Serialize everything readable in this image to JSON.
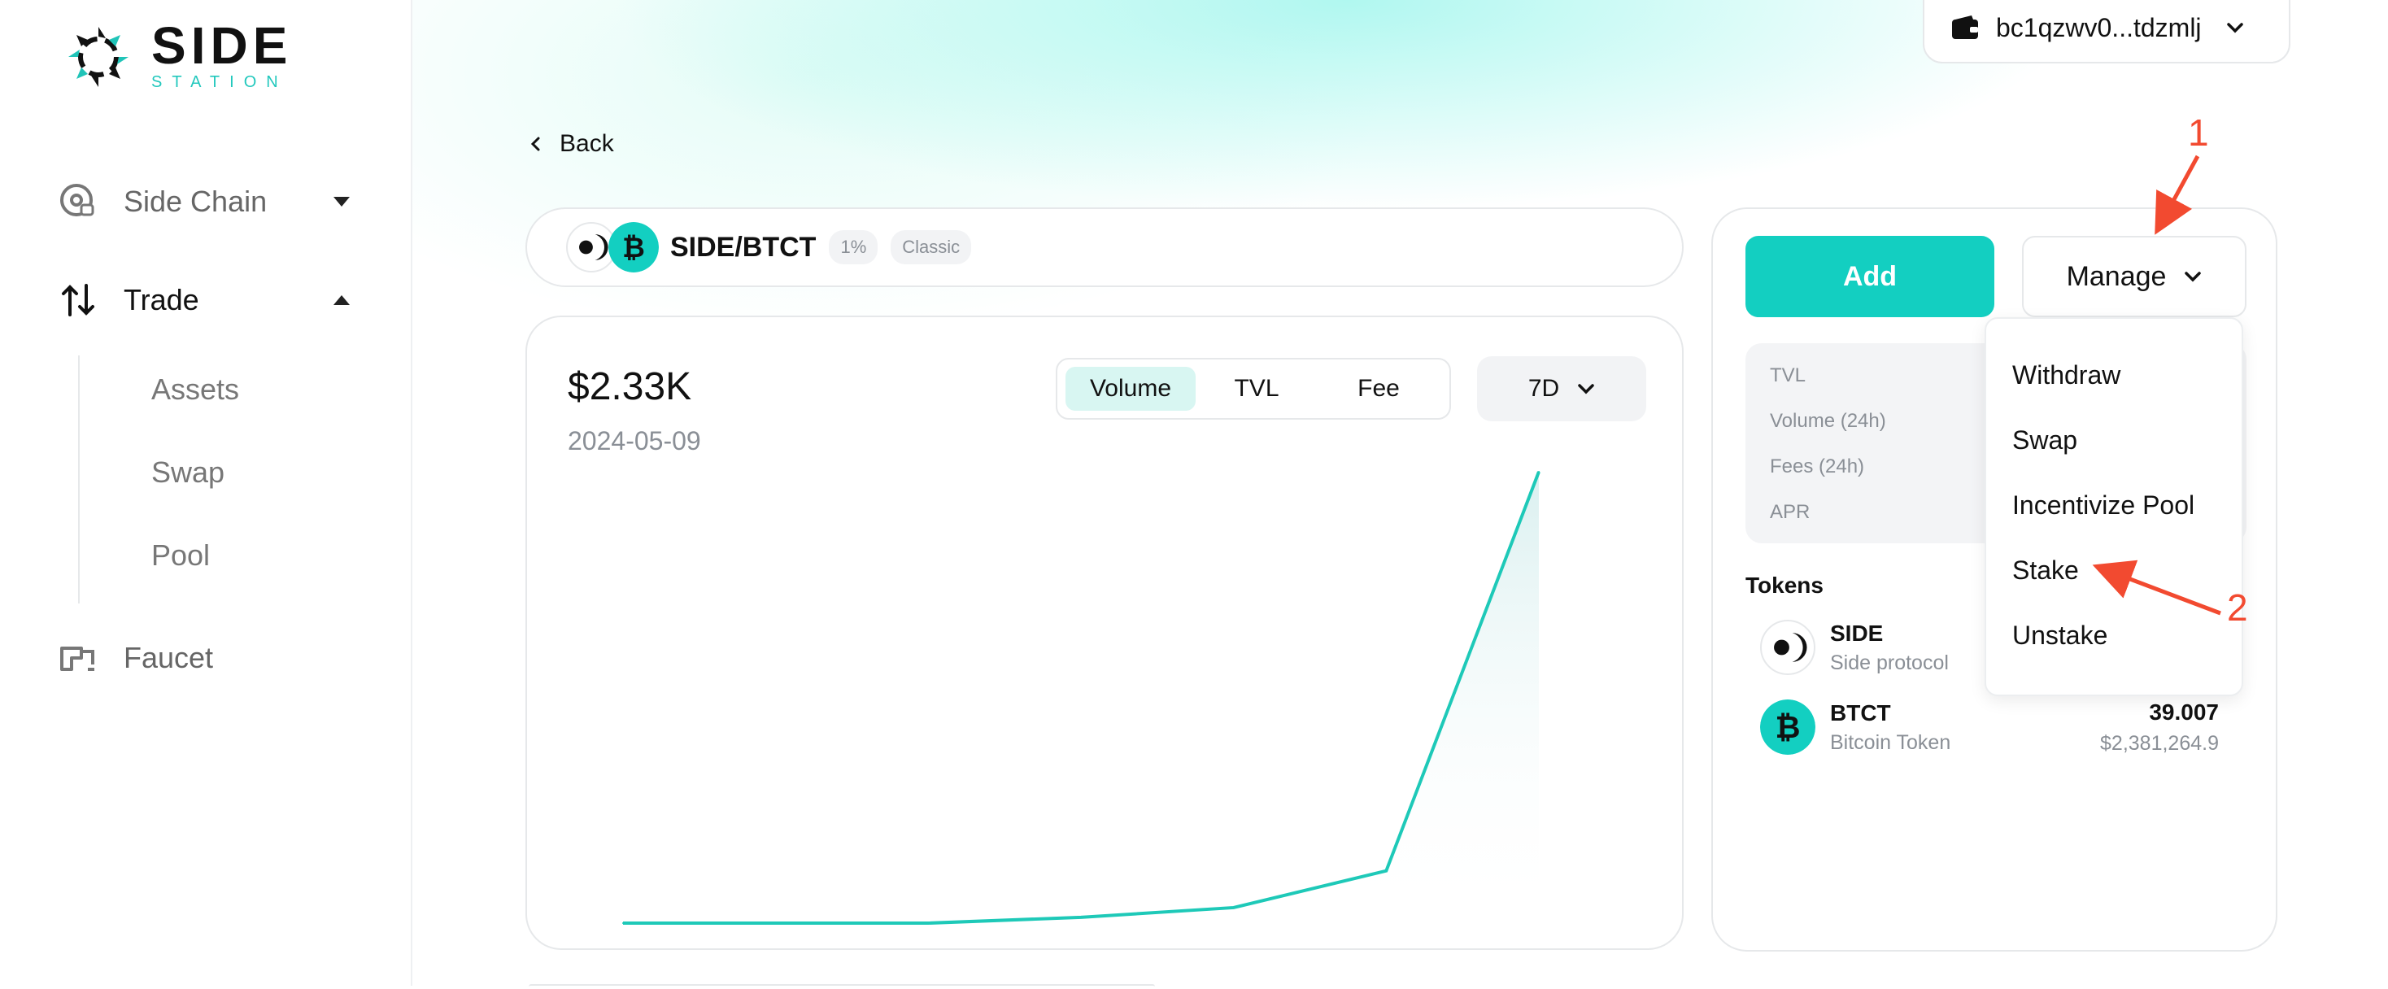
{
  "brand": {
    "title": "SIDE",
    "subtitle": "STATION",
    "accent": "#13cfc1"
  },
  "sidebar": {
    "items": [
      {
        "label": "Side Chain",
        "icon": "side-chain-icon"
      },
      {
        "label": "Trade",
        "icon": "trade-arrows-icon"
      },
      {
        "label": "Faucet",
        "icon": "faucet-icon"
      }
    ],
    "trade_sub": [
      "Assets",
      "Swap",
      "Pool"
    ]
  },
  "wallet": {
    "address": "bc1qzwv0...tdzmlj"
  },
  "back_label": "Back",
  "pair": {
    "title": "SIDE/BTCT",
    "fee": "1%",
    "kind": "Classic"
  },
  "chart": {
    "value": "$2.33K",
    "date": "2024-05-09",
    "tabs": [
      "Volume",
      "TVL",
      "Fee"
    ],
    "active_tab": "Volume",
    "period": "7D"
  },
  "chart_data": {
    "type": "area",
    "x": [
      1,
      2,
      3,
      4,
      5,
      6,
      7
    ],
    "values": [
      0,
      0,
      0,
      0.03,
      0.08,
      0.27,
      2.33
    ],
    "title": "",
    "xlabel": "",
    "ylabel": "",
    "grid": false,
    "color": "#1ec9b8"
  },
  "actions": {
    "add": "Add",
    "manage": "Manage"
  },
  "stats": [
    "TVL",
    "Volume (24h)",
    "Fees (24h)",
    "APR"
  ],
  "tokens": {
    "heading": "Tokens",
    "items": [
      {
        "symbol": "SIDE",
        "name": "Side protocol",
        "amount": "",
        "usd": ""
      },
      {
        "symbol": "BTCT",
        "name": "Bitcoin Token",
        "amount": "39.007",
        "usd": "$2,381,264.9"
      }
    ]
  },
  "manage_menu": [
    "Withdraw",
    "Swap",
    "Incentivize Pool",
    "Stake",
    "Unstake"
  ],
  "annotations": [
    "1",
    "2"
  ]
}
